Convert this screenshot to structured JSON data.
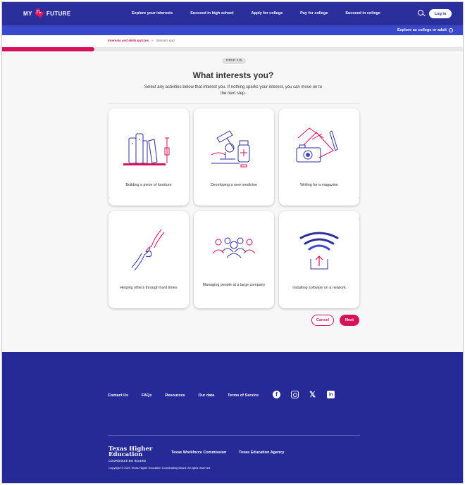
{
  "header": {
    "logo": {
      "left": "MY",
      "badge": "TX",
      "right": "FUTURE"
    },
    "nav": [
      "Explore your interests",
      "Succeed in high school",
      "Apply for college",
      "Pay for college",
      "Succeed in college"
    ],
    "login_label": "Log in",
    "explore_label": "Explore as college or adult"
  },
  "breadcrumb": {
    "parent": "Interests and skills quizzes",
    "separator": "»",
    "current": "Interests quiz"
  },
  "progress": {
    "fraction": 0.2
  },
  "quiz": {
    "step_label": "STEP 1/5",
    "title": "What interests you?",
    "subtitle": "Select any activities below that interest you. If nothing sparks your interest, you can move on to the next step.",
    "cards": [
      {
        "label": "Building a piece of furniture",
        "icon": "furniture-icon"
      },
      {
        "label": "Developing a new medicine",
        "icon": "microscope-icon"
      },
      {
        "label": "Writing for a magazine",
        "icon": "camera-icon"
      },
      {
        "label": "Helping others through hard times",
        "icon": "helping-hands-icon"
      },
      {
        "label": "Managing people at a large company",
        "icon": "people-group-icon"
      },
      {
        "label": "Installing software on a network",
        "icon": "wifi-upload-icon"
      }
    ],
    "cancel_label": "Cancel",
    "next_label": "Next"
  },
  "footer": {
    "links": [
      "Contact Us",
      "FAQs",
      "Resources",
      "Our data",
      "Terms of Service"
    ],
    "social_icons": [
      "facebook-icon",
      "instagram-icon",
      "x-icon",
      "linkedin-icon"
    ],
    "thecb_line1": "Texas Higher",
    "thecb_line2": "Education",
    "thecb_line3": "COORDINATING BOARD",
    "partner1": "Texas Workforce Commission",
    "partner2": "Texas Education Agency",
    "copyright": "Copyright © 2023 Texas Higher Education Coordinating Board. All rights reserved."
  },
  "colors": {
    "navy": "#2b2f9c",
    "accent": "#d6125a",
    "footer": "#262a97"
  }
}
